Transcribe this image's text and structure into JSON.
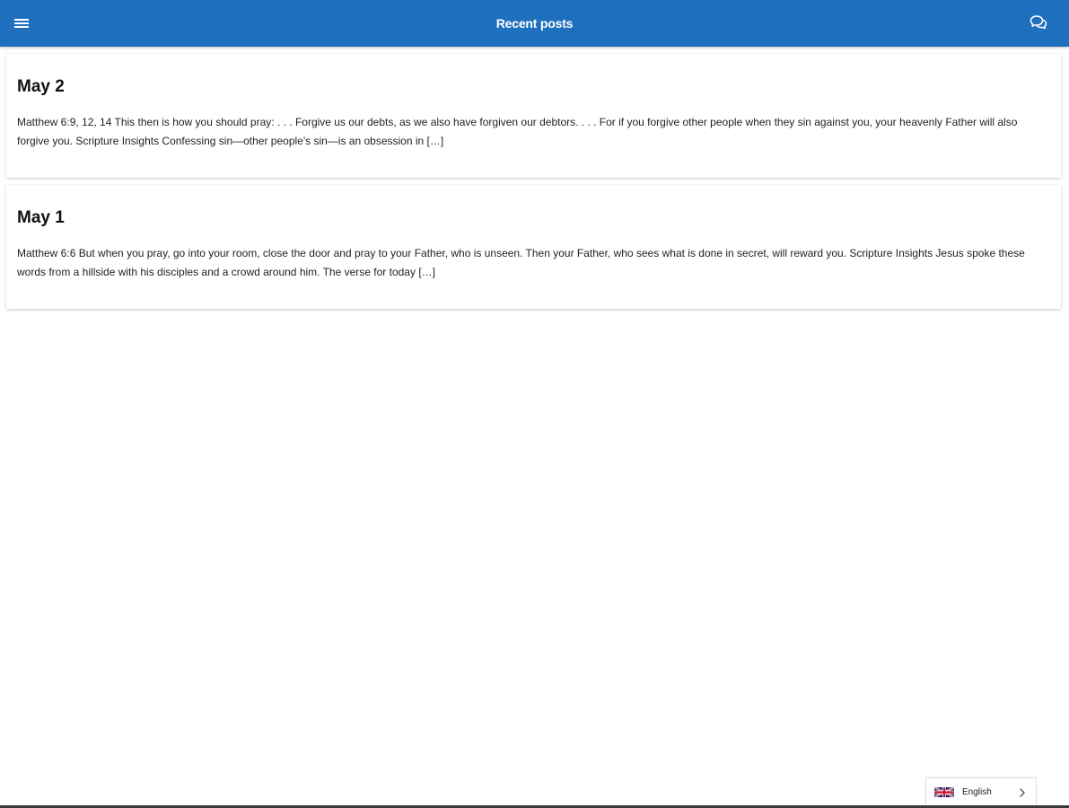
{
  "header": {
    "title": "Recent posts",
    "menu_icon": "hamburger-menu-icon",
    "chat_icon": "chat-bubbles-icon",
    "background_color": "#1e70bf"
  },
  "posts": [
    {
      "title": "May 2",
      "excerpt": "Matthew 6:9, 12, 14 This then is how you should pray: . . . Forgive us our debts, as we also have forgiven our debtors. . . . For if you forgive other people when they sin against you, your heavenly Father will also forgive you. Scripture Insights Confessing sin—other people's sin—is an obsession in […]"
    },
    {
      "title": "May 1",
      "excerpt": "Matthew 6:6 But when you pray, go into your room, close the door and pray to your Father, who is unseen. Then your Father, who sees what is done in secret, will reward you. Scripture Insights Jesus spoke these words from a hillside with his disciples and a crowd around him. The verse for today […]"
    }
  ],
  "language_selector": {
    "label": "English",
    "flag_icon": "uk-flag-icon",
    "chevron_icon": "chevron-right-icon"
  }
}
